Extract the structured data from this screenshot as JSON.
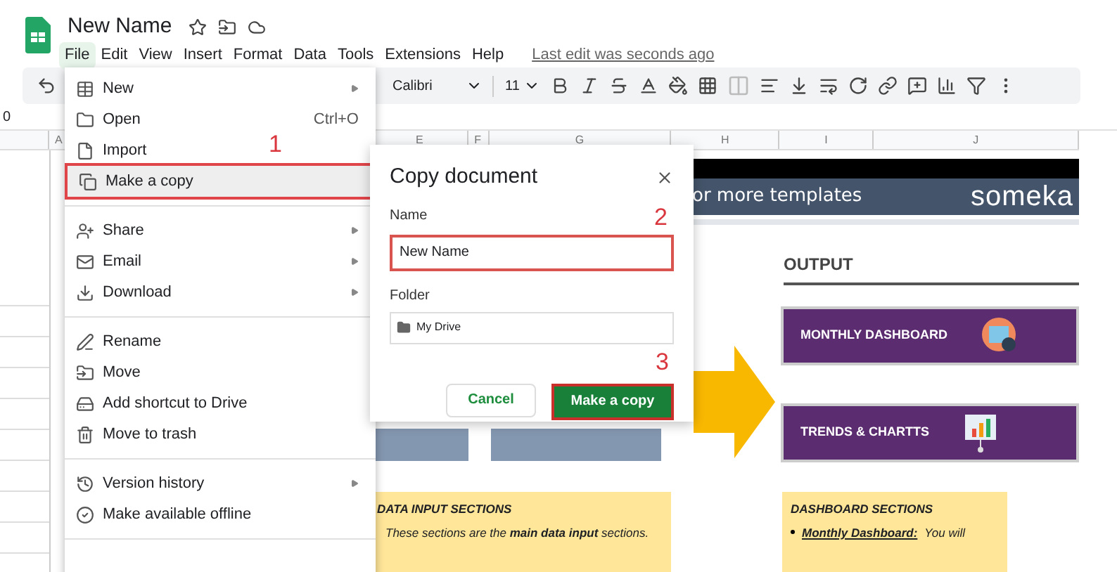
{
  "app": {
    "title": "New Name",
    "last_edit": "Last edit was seconds ago"
  },
  "menubar": [
    {
      "label": "File",
      "selected": true
    },
    {
      "label": "Edit",
      "selected": false
    },
    {
      "label": "View",
      "selected": false
    },
    {
      "label": "Insert",
      "selected": false
    },
    {
      "label": "Format",
      "selected": false
    },
    {
      "label": "Data",
      "selected": false
    },
    {
      "label": "Tools",
      "selected": false
    },
    {
      "label": "Extensions",
      "selected": false
    },
    {
      "label": "Help",
      "selected": false
    }
  ],
  "toolbar": {
    "font": "Calibri",
    "size": "11"
  },
  "name_box": "0",
  "columns": [
    "A",
    "E",
    "F",
    "G",
    "H",
    "I",
    "J"
  ],
  "file_menu": [
    {
      "kind": "item",
      "label": "New",
      "submenu": true,
      "selected": false
    },
    {
      "kind": "item",
      "label": "Open",
      "shortcut": "Ctrl+O",
      "submenu": false,
      "selected": false
    },
    {
      "kind": "item",
      "label": "Import",
      "submenu": false,
      "selected": false
    },
    {
      "kind": "item",
      "label": "Make a copy",
      "submenu": false,
      "selected": true
    },
    {
      "kind": "divider"
    },
    {
      "kind": "item",
      "label": "Share",
      "submenu": true,
      "selected": false
    },
    {
      "kind": "item",
      "label": "Email",
      "submenu": true,
      "selected": false
    },
    {
      "kind": "item",
      "label": "Download",
      "submenu": true,
      "selected": false
    },
    {
      "kind": "divider"
    },
    {
      "kind": "item",
      "label": "Rename",
      "submenu": false,
      "selected": false
    },
    {
      "kind": "item",
      "label": "Move",
      "submenu": false,
      "selected": false
    },
    {
      "kind": "item",
      "label": "Add shortcut to Drive",
      "submenu": false,
      "selected": false
    },
    {
      "kind": "item",
      "label": "Move to trash",
      "submenu": false,
      "selected": false
    },
    {
      "kind": "divider"
    },
    {
      "kind": "item",
      "label": "Version history",
      "submenu": true,
      "selected": false
    },
    {
      "kind": "item",
      "label": "Make available offline",
      "submenu": false,
      "selected": false
    },
    {
      "kind": "divider"
    }
  ],
  "steps": [
    "1",
    "2",
    "3"
  ],
  "dialog": {
    "title": "Copy document",
    "name_label": "Name",
    "name_value": "New Name",
    "folder_label": "Folder",
    "folder_value": "My Drive",
    "cancel": "Cancel",
    "confirm": "Make a copy"
  },
  "sheet": {
    "banner_text": "or more templates",
    "logo": "someka",
    "output_heading": "OUTPUT",
    "output_buttons": [
      "MONTHLY DASHBOARD",
      "TRENDS & CHARTTS"
    ],
    "input_note": {
      "title": "DATA INPUT SECTIONS",
      "text": "These sections are the **main data input** sections."
    },
    "dashboard_note": {
      "title": "DASHBOARD SECTIONS",
      "term": "Monthly Dashboard:",
      "text": "You will"
    }
  }
}
